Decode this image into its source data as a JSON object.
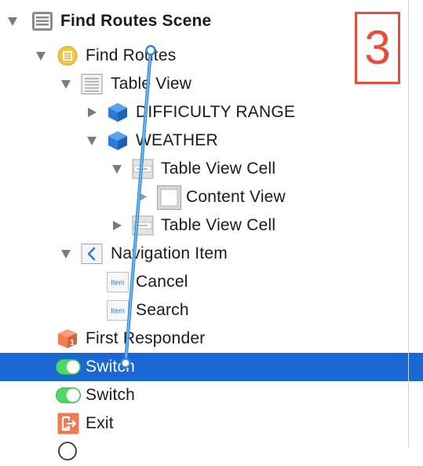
{
  "step_badge": {
    "number": "3",
    "color": "#e74c3c"
  },
  "colors": {
    "selection": "#1a67d6",
    "connection_line": "#4aa3e6",
    "toggle_on": "#4cd964",
    "view_controller_icon": "#f5c542",
    "cube_icon": "#2b7bd6",
    "first_responder_icon": "#f08050",
    "exit_icon": "#f07a50"
  },
  "outline": {
    "rows": [
      {
        "name": "find-routes-scene",
        "label": "Find Routes Scene",
        "icon": "scene-icon",
        "expanded": true
      },
      {
        "name": "find-routes-controller",
        "label": "Find Routes",
        "icon": "view-controller-icon",
        "expanded": true
      },
      {
        "name": "table-view",
        "label": "Table View",
        "icon": "table-view-icon",
        "expanded": true
      },
      {
        "name": "difficulty-range-section",
        "label": "DIFFICULTY RANGE",
        "icon": "cube-icon",
        "expanded": false
      },
      {
        "name": "weather-section",
        "label": "WEATHER",
        "icon": "cube-icon",
        "expanded": true
      },
      {
        "name": "table-view-cell-1",
        "label": "Table View Cell",
        "icon": "table-cell-icon",
        "expanded": true
      },
      {
        "name": "content-view",
        "label": "Content View",
        "icon": "view-icon",
        "expanded": false
      },
      {
        "name": "table-view-cell-2",
        "label": "Table View Cell",
        "icon": "table-cell-icon",
        "expanded": false
      },
      {
        "name": "navigation-item",
        "label": "Navigation Item",
        "icon": "navigation-back-icon",
        "expanded": true
      },
      {
        "name": "cancel-item",
        "label": "Cancel",
        "icon": "bar-item-icon",
        "icon_text": "Item"
      },
      {
        "name": "search-item",
        "label": "Search",
        "icon": "bar-item-icon",
        "icon_text": "Item"
      },
      {
        "name": "first-responder",
        "label": "First Responder",
        "icon": "first-responder-icon",
        "icon_text": "1"
      },
      {
        "name": "switch-selected",
        "label": "Switch",
        "icon": "toggle-switch-icon",
        "selected": true
      },
      {
        "name": "switch",
        "label": "Switch",
        "icon": "toggle-switch-icon"
      },
      {
        "name": "exit",
        "label": "Exit",
        "icon": "exit-icon"
      }
    ]
  }
}
